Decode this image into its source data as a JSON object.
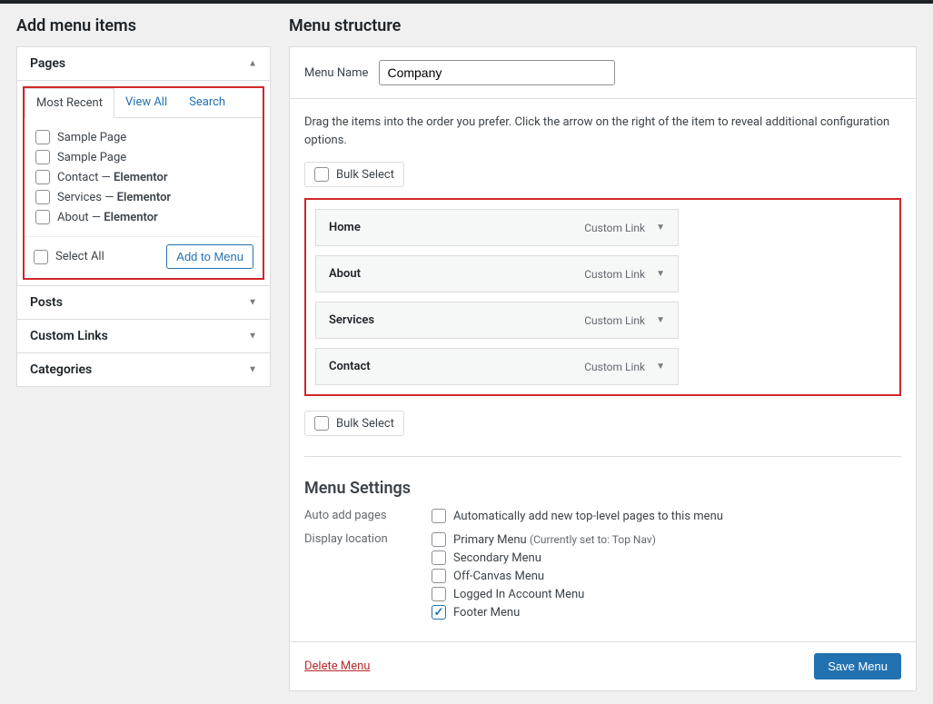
{
  "left": {
    "title": "Add menu items",
    "panels": {
      "pages": "Pages",
      "posts": "Posts",
      "custom_links": "Custom Links",
      "categories": "Categories"
    },
    "tabs": {
      "most_recent": "Most Recent",
      "view_all": "View All",
      "search": "Search"
    },
    "page_items": [
      {
        "label": "Sample Page",
        "suffix": ""
      },
      {
        "label": "Sample Page",
        "suffix": ""
      },
      {
        "label": "Contact",
        "suffix": "Elementor"
      },
      {
        "label": "Services",
        "suffix": "Elementor"
      },
      {
        "label": "About",
        "suffix": "Elementor"
      }
    ],
    "select_all": "Select All",
    "add_to_menu": "Add to Menu"
  },
  "right": {
    "title": "Menu structure",
    "menu_name_label": "Menu Name",
    "menu_name_value": "Company",
    "instructions": "Drag the items into the order you prefer. Click the arrow on the right of the item to reveal additional configuration options.",
    "bulk_select": "Bulk Select",
    "items": [
      {
        "title": "Home",
        "type": "Custom Link"
      },
      {
        "title": "About",
        "type": "Custom Link"
      },
      {
        "title": "Services",
        "type": "Custom Link"
      },
      {
        "title": "Contact",
        "type": "Custom Link"
      }
    ],
    "settings": {
      "heading": "Menu Settings",
      "auto_add_label": "Auto add pages",
      "auto_add_option": "Automatically add new top-level pages to this menu",
      "display_label": "Display location",
      "locations": [
        {
          "label": "Primary Menu",
          "sub": "(Currently set to: Top Nav)",
          "checked": false
        },
        {
          "label": "Secondary Menu",
          "sub": "",
          "checked": false
        },
        {
          "label": "Off-Canvas Menu",
          "sub": "",
          "checked": false
        },
        {
          "label": "Logged In Account Menu",
          "sub": "",
          "checked": false
        },
        {
          "label": "Footer Menu",
          "sub": "",
          "checked": true
        }
      ]
    },
    "delete": "Delete Menu",
    "save": "Save Menu"
  }
}
